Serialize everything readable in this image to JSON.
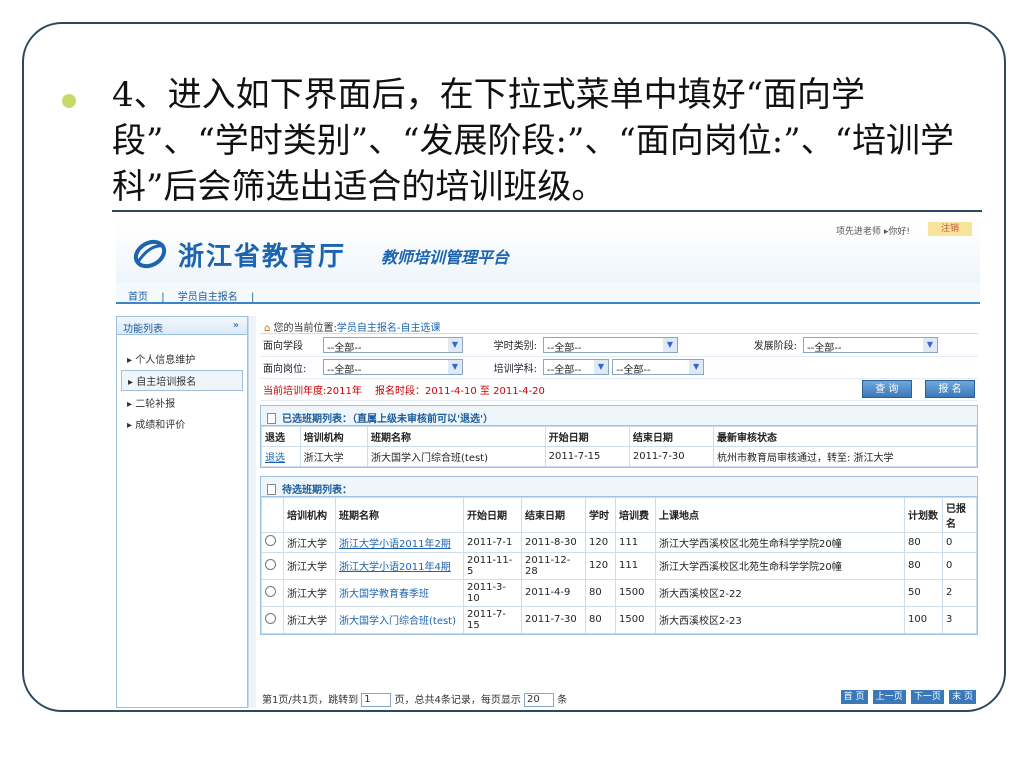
{
  "slide": {
    "text": "4、进入如下界面后，在下拉式菜单中填好“面向学段”、“学时类别”、“发展阶段:”、“面向岗位:”、“培训学科”后会筛选出适合的培训班级。"
  },
  "header": {
    "logo_main": "浙江省教育厅",
    "logo_sub": "教师培训管理平台",
    "user_greeting": "项先进老师 ▸你好!",
    "logout": "注销"
  },
  "nav": {
    "items": [
      "首页",
      "|",
      "学员自主报名",
      "|"
    ]
  },
  "sidebar": {
    "title": "功能列表",
    "items": [
      "个人信息维护",
      "自主培训报名",
      "二轮补报",
      "成绩和评价"
    ]
  },
  "breadcrumb": {
    "prefix": "您的当前位置:",
    "path": "学员自主报名-自主选课"
  },
  "filters": {
    "stage_label": "面向学段",
    "stage_value": "--全部--",
    "hours_label": "学时类别:",
    "hours_value": "--全部--",
    "dev_label": "发展阶段:",
    "dev_value": "--全部--",
    "post_label": "面向岗位:",
    "post_value": "--全部--",
    "subject_label": "培训学科:",
    "subject_value1": "--全部--",
    "subject_value2": "--全部--",
    "year_info": "当前培训年度:2011年　 报名时段：2011-4-10 至 2011-4-20",
    "query_btn": "查 询",
    "signup_btn": "报 名"
  },
  "selected": {
    "title": "已选班期列表：（直属上级未审核前可以'退选'）",
    "headers": [
      "退选",
      "培训机构",
      "班期名称",
      "开始日期",
      "结束日期",
      "最新审核状态"
    ],
    "rows": [
      {
        "withdraw": "退选",
        "org": "浙江大学",
        "name": "浙大国学入门综合班(test)",
        "start": "2011-7-15",
        "end": "2011-7-30",
        "status": "杭州市教育局审核通过，转至: 浙江大学"
      }
    ]
  },
  "candidates": {
    "title": "待选班期列表：",
    "headers": [
      "",
      "培训机构",
      "班期名称",
      "开始日期",
      "结束日期",
      "学时",
      "培训费",
      "上课地点",
      "计划数",
      "已报名"
    ],
    "rows": [
      {
        "org": "浙江大学",
        "name": "浙江大学小语2011年2期",
        "start": "2011-7-1",
        "end": "2011-8-30",
        "hours": "120",
        "fee": "111",
        "place": "浙江大学西溪校区北苑生命科学学院20幢",
        "plan": "80",
        "enrolled": "0"
      },
      {
        "org": "浙江大学",
        "name": "浙江大学小语2011年4期",
        "start": "2011-11-5",
        "end": "2011-12-28",
        "hours": "120",
        "fee": "111",
        "place": "浙江大学西溪校区北苑生命科学学院20幢",
        "plan": "80",
        "enrolled": "0"
      },
      {
        "org": "浙江大学",
        "name": "浙大国学教育春季班",
        "start": "2011-3-10",
        "end": "2011-4-9",
        "hours": "80",
        "fee": "1500",
        "place": "浙大西溪校区2-22",
        "plan": "50",
        "enrolled": "2"
      },
      {
        "org": "浙江大学",
        "name": "浙大国学入门综合班(test)",
        "start": "2011-7-15",
        "end": "2011-7-30",
        "hours": "80",
        "fee": "1500",
        "place": "浙大西溪校区2-23",
        "plan": "100",
        "enrolled": "3"
      }
    ]
  },
  "pager": {
    "text1": "第1页/共1页，跳转到",
    "page_value": "1",
    "text2": "页，总共4条记录，每页显示",
    "size_value": "20",
    "text3": "条",
    "first": "首 页",
    "prev": "上一页",
    "next": "下一页",
    "last": "末 页"
  },
  "colors": {
    "brand": "#1c64b0",
    "accent_bullet": "#c8d96a",
    "frame": "#2b4a5c"
  }
}
